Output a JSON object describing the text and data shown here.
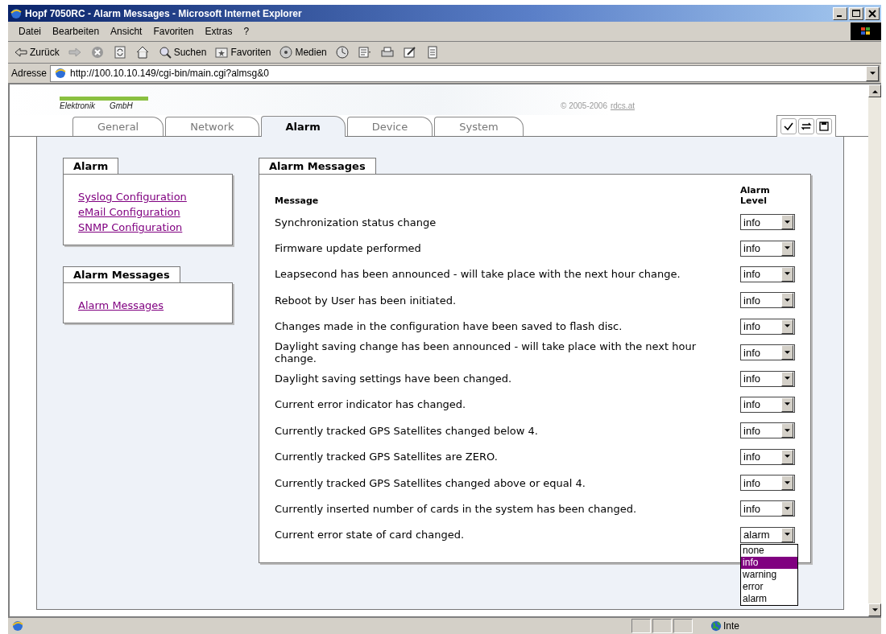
{
  "window": {
    "title": "Hopf 7050RC - Alarm Messages - Microsoft Internet Explorer"
  },
  "menu": [
    "Datei",
    "Bearbeiten",
    "Ansicht",
    "Favoriten",
    "Extras",
    "?"
  ],
  "toolbar": [
    {
      "kind": "back",
      "label": "Zurück"
    },
    {
      "kind": "forward"
    },
    {
      "kind": "stop"
    },
    {
      "kind": "refresh"
    },
    {
      "kind": "home"
    },
    {
      "kind": "search",
      "label": "Suchen"
    },
    {
      "kind": "favorites",
      "label": "Favoriten"
    },
    {
      "kind": "media",
      "label": "Medien"
    },
    {
      "kind": "history"
    },
    {
      "kind": "mail"
    },
    {
      "kind": "print"
    },
    {
      "kind": "edit"
    },
    {
      "kind": "discuss"
    }
  ],
  "address": {
    "label": "Adresse",
    "url": "http://100.10.10.149/cgi-bin/main.cgi?almsg&0"
  },
  "banner": {
    "logo_line": [
      "Elektronik",
      "GmbH"
    ],
    "copyright": "© 2005-2006",
    "copyright_link": "rdcs.at"
  },
  "tabs": [
    {
      "label": "General",
      "selected": false
    },
    {
      "label": "Network",
      "selected": false
    },
    {
      "label": "Alarm",
      "selected": true
    },
    {
      "label": "Device",
      "selected": false
    },
    {
      "label": "System",
      "selected": false
    }
  ],
  "sidebar": [
    {
      "title": "Alarm",
      "links": [
        "Syslog Configuration",
        "eMail Configuration",
        "SNMP Configuration"
      ]
    },
    {
      "title": "Alarm Messages",
      "links": [
        "Alarm Messages"
      ]
    }
  ],
  "main": {
    "title": "Alarm Messages",
    "columns": [
      "Message",
      "Alarm Level"
    ],
    "rows": [
      {
        "message": "Synchronization status change",
        "level": "info"
      },
      {
        "message": "Firmware update performed",
        "level": "info"
      },
      {
        "message": "Leapsecond has been announced - will take place with the next hour change.",
        "level": "info"
      },
      {
        "message": "Reboot by User has been initiated.",
        "level": "info"
      },
      {
        "message": "Changes made in the configuration have been saved to flash disc.",
        "level": "info"
      },
      {
        "message": "Daylight saving change has been announced - will take place with the next hour change.",
        "level": "info"
      },
      {
        "message": "Daylight saving settings have been changed.",
        "level": "info"
      },
      {
        "message": "Current error indicator has changed.",
        "level": "info"
      },
      {
        "message": "Currently tracked GPS Satellites changed below 4.",
        "level": "info"
      },
      {
        "message": "Currently tracked GPS Satellites are ZERO.",
        "level": "info"
      },
      {
        "message": "Currently tracked GPS Satellites changed above or equal 4.",
        "level": "info"
      },
      {
        "message": "Currently inserted number of cards in the system has been changed.",
        "level": "info"
      },
      {
        "message": "Current error state of card changed.",
        "level": "alarm"
      }
    ]
  },
  "dropdown": {
    "options": [
      {
        "label": "none",
        "selected": false
      },
      {
        "label": "info",
        "selected": true
      },
      {
        "label": "warning",
        "selected": false
      },
      {
        "label": "error",
        "selected": false
      },
      {
        "label": "alarm",
        "selected": false
      }
    ]
  },
  "status_bar": {
    "zone": "Inte"
  }
}
